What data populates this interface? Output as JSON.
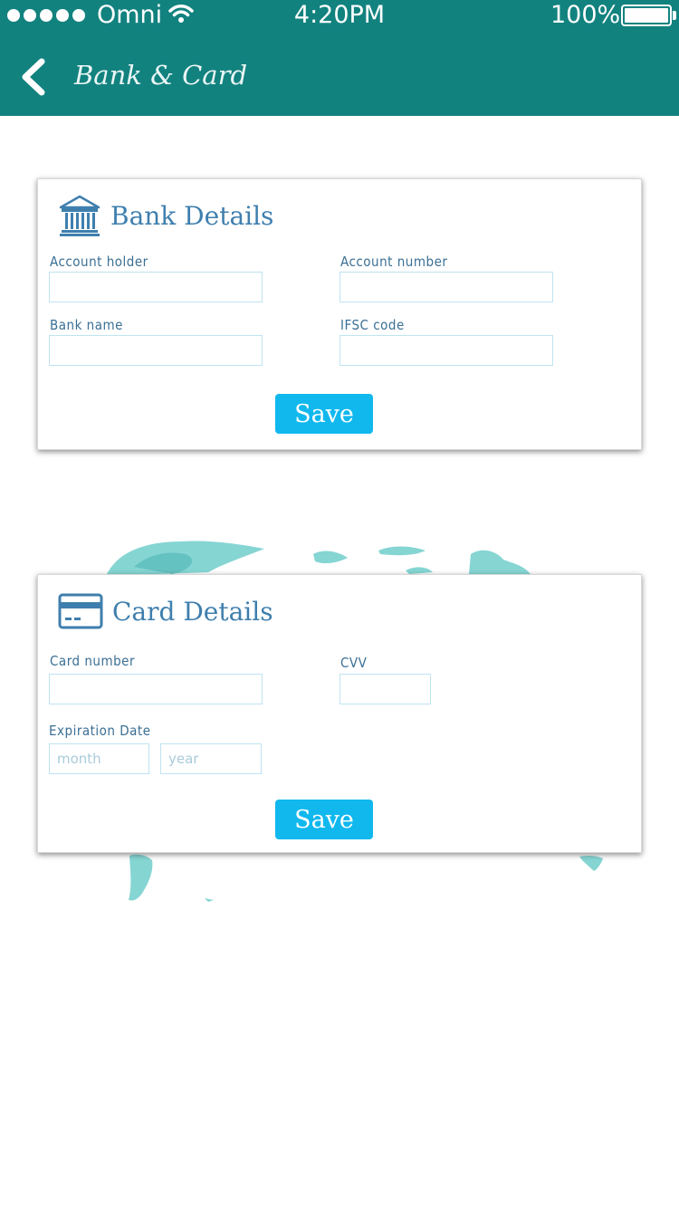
{
  "status_bar": {
    "carrier": "Omni",
    "time": "4:20PM",
    "battery": "100%",
    "signal_icon": "signal-dots-icon",
    "wifi_icon": "wifi-icon",
    "battery_icon": "battery-icon"
  },
  "header": {
    "title": "Bank & Card",
    "back_icon": "chevron-left-icon",
    "background": "#12827f"
  },
  "bank": {
    "title": "Bank Details",
    "icon": "bank-icon",
    "fields": {
      "account_holder": {
        "label": "Account holder",
        "value": ""
      },
      "account_number": {
        "label": "Account number",
        "value": ""
      },
      "bank_name": {
        "label": "Bank name",
        "value": ""
      },
      "ifsc_code": {
        "label": "IFSC code",
        "value": ""
      }
    },
    "save_label": "Save"
  },
  "card": {
    "title": "Card Details",
    "icon": "credit-card-icon",
    "fields": {
      "card_number": {
        "label": "Card number",
        "value": ""
      },
      "cvv": {
        "label": "CVV",
        "value": ""
      },
      "expiration": {
        "label": "Expiration Date",
        "month_placeholder": "month",
        "year_placeholder": "year"
      }
    },
    "save_label": "Save"
  },
  "colors": {
    "accent": "#10b8ee",
    "heading": "#3f7fae",
    "map": "#7fd3d1"
  }
}
